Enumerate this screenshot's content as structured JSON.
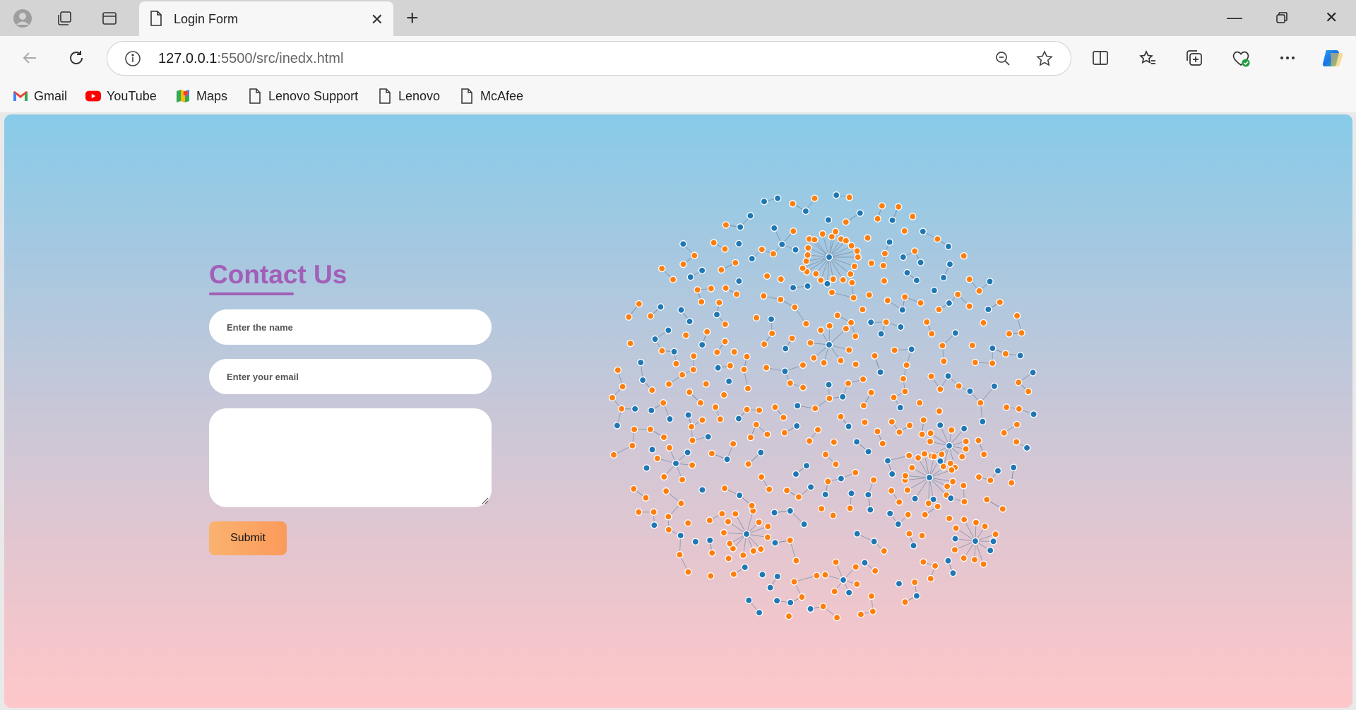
{
  "browser": {
    "tab_title": "Login Form",
    "url_host": "127.0.0.1",
    "url_path": ":5500/src/inedx.html",
    "bookmarks": [
      {
        "label": "Gmail",
        "icon": "gmail-icon"
      },
      {
        "label": "YouTube",
        "icon": "youtube-icon"
      },
      {
        "label": "Maps",
        "icon": "maps-icon"
      },
      {
        "label": "Lenovo Support",
        "icon": "page-icon"
      },
      {
        "label": "Lenovo",
        "icon": "page-icon"
      },
      {
        "label": "McAfee",
        "icon": "page-icon"
      }
    ]
  },
  "form": {
    "heading": "Contact Us",
    "name_placeholder": "Enter the name",
    "email_placeholder": "Enter your email",
    "message_value": "",
    "submit_label": "Submit"
  },
  "colors": {
    "accent": "#a25fb8",
    "node_blue": "#1f77b4",
    "node_orange": "#ff7f0e",
    "link": "#7a8fa6",
    "submit_start": "#fbb270",
    "submit_end": "#fb9a5a"
  }
}
